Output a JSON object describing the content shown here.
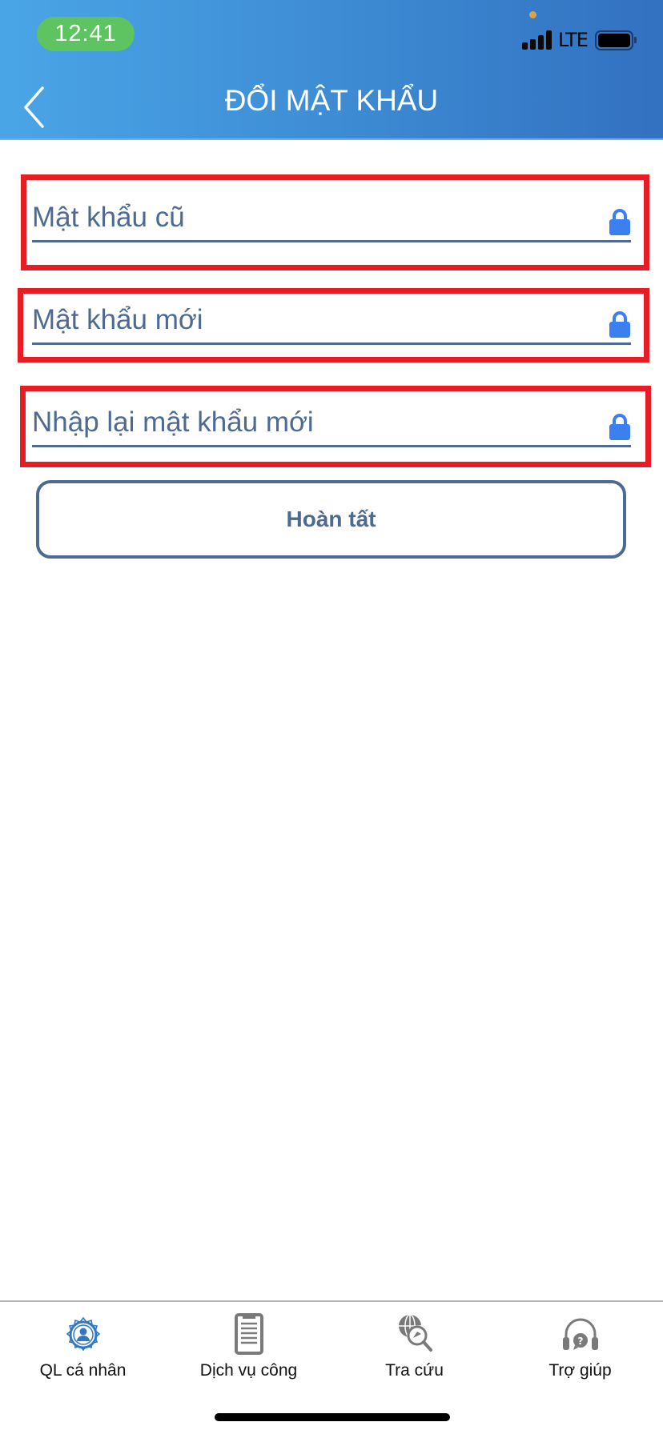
{
  "status_bar": {
    "time": "12:41",
    "network": "LTE",
    "signal_bars": 4,
    "battery_level": 1.0
  },
  "header": {
    "title": "ĐỔI MẬT KHẨU",
    "back_icon": "chevron-left-icon"
  },
  "form": {
    "fields": [
      {
        "placeholder": "Mật khẩu cũ",
        "value": "",
        "icon": "lock-icon"
      },
      {
        "placeholder": "Mật khẩu mới",
        "value": "",
        "icon": "lock-icon"
      },
      {
        "placeholder": "Nhập lại mật khẩu mới",
        "value": "",
        "icon": "lock-icon"
      }
    ],
    "submit_label": "Hoàn tất"
  },
  "tabbar": {
    "items": [
      {
        "label": "QL cá nhân",
        "icon": "user-gear-icon",
        "active": true
      },
      {
        "label": "Dịch vụ công",
        "icon": "clipboard-icon",
        "active": false
      },
      {
        "label": "Tra cứu",
        "icon": "globe-search-icon",
        "active": false
      },
      {
        "label": "Trợ giúp",
        "icon": "headset-help-icon",
        "active": false
      }
    ]
  },
  "colors": {
    "header_start": "#4aa5e6",
    "header_end": "#3271c0",
    "text_primary": "#4d6a93",
    "lock_icon": "#3b7ff0",
    "highlight_border": "#e81c24",
    "tab_active": "#2f78c4",
    "tab_inactive": "#7a7a7a",
    "time_pill": "#5ec361"
  }
}
